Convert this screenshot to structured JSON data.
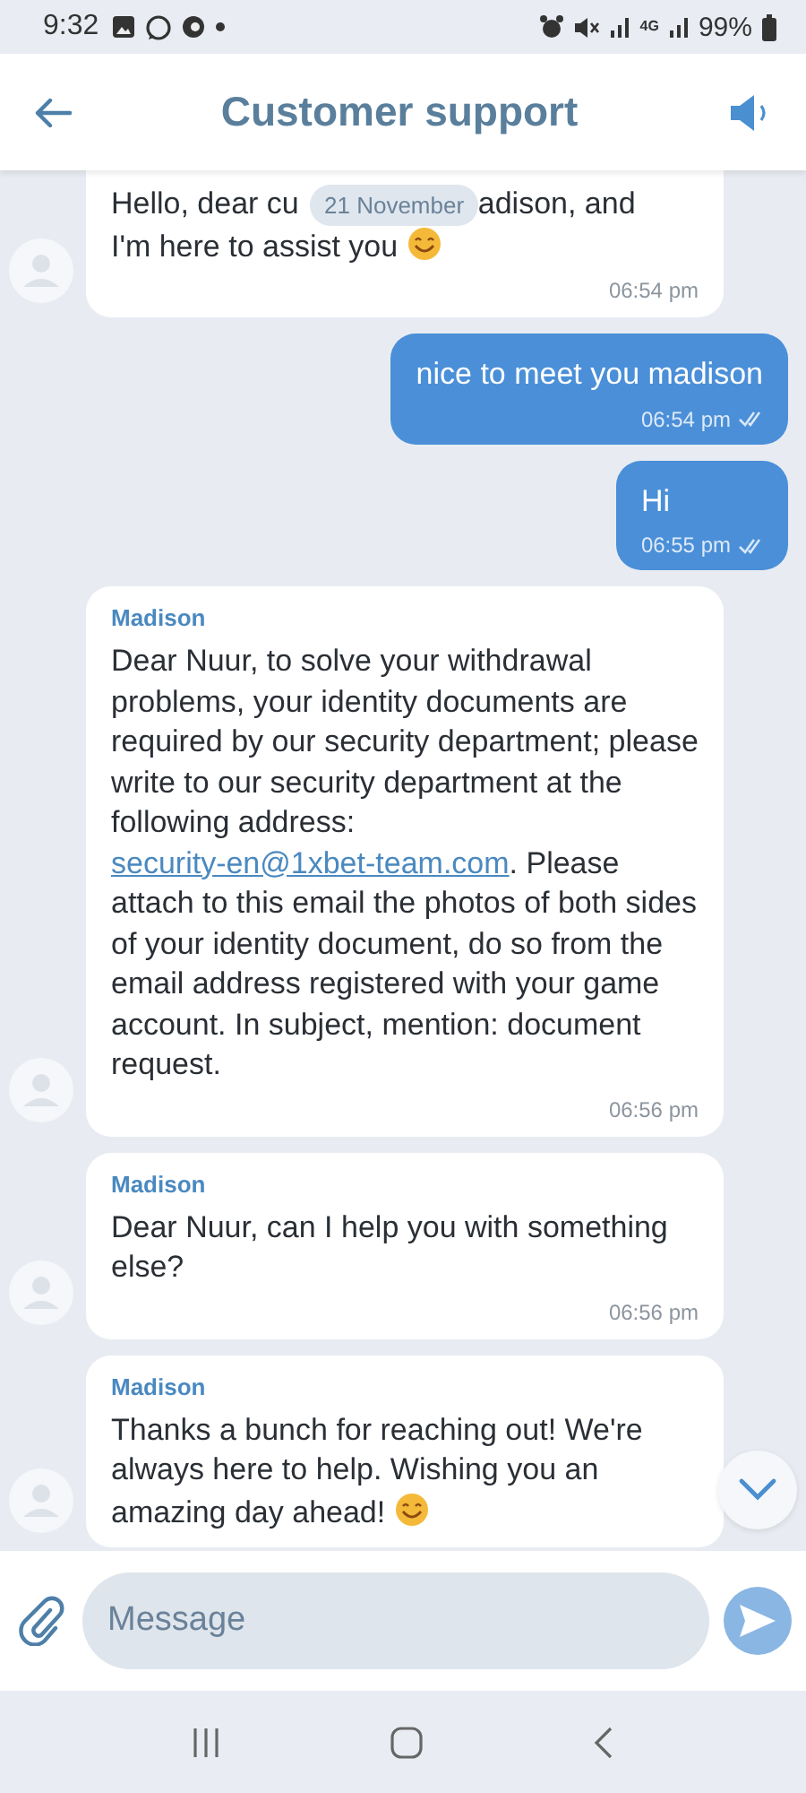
{
  "status_bar": {
    "time": "9:32",
    "network": "4G",
    "battery": "99%"
  },
  "header": {
    "title": "Customer support"
  },
  "date_pill": "21 November",
  "messages": [
    {
      "kind": "incoming",
      "lines": [
        [
          {
            "kind": "text",
            "text": "Hello, dear cu"
          },
          {
            "kind": "hidden"
          },
          {
            "kind": "text",
            "text": "adison, and"
          }
        ],
        [
          {
            "kind": "text",
            "text": "I'm here to assist you"
          },
          {
            "kind": "emoji"
          }
        ]
      ],
      "time": "06:54 pm"
    },
    {
      "kind": "outgoing",
      "parts": [
        {
          "kind": "text",
          "text": "nice to meet you madison"
        }
      ],
      "time": "06:54 pm",
      "read": true
    },
    {
      "kind": "outgoing",
      "parts": [
        {
          "kind": "text",
          "text": "Hi"
        }
      ],
      "time": "06:55 pm",
      "read": true
    },
    {
      "kind": "incoming",
      "sender": "Madison",
      "parts": [
        {
          "kind": "text",
          "text": "Dear Nuur, to solve your withdrawal problems, your identity documents are required by our security department; please write to our security department at the following address: "
        },
        {
          "kind": "link",
          "text": "security-en@1xbet-team.com"
        },
        {
          "kind": "text",
          "text": ". Please attach to this email the photos of both sides of your identity document, do so from the email address registered with your game account. In subject, mention: document request."
        }
      ],
      "time": "06:56 pm"
    },
    {
      "kind": "incoming",
      "sender": "Madison",
      "parts": [
        {
          "kind": "text",
          "text": "Dear Nuur, can I help you with something else?"
        }
      ],
      "time": "06:56 pm"
    },
    {
      "kind": "incoming",
      "sender": "Madison",
      "parts": [
        {
          "kind": "text",
          "text": "Thanks a bunch for reaching out! We're always here to help. Wishing you an amazing day ahead!"
        },
        {
          "kind": "emoji"
        }
      ]
    }
  ],
  "composer": {
    "placeholder": "Message"
  }
}
